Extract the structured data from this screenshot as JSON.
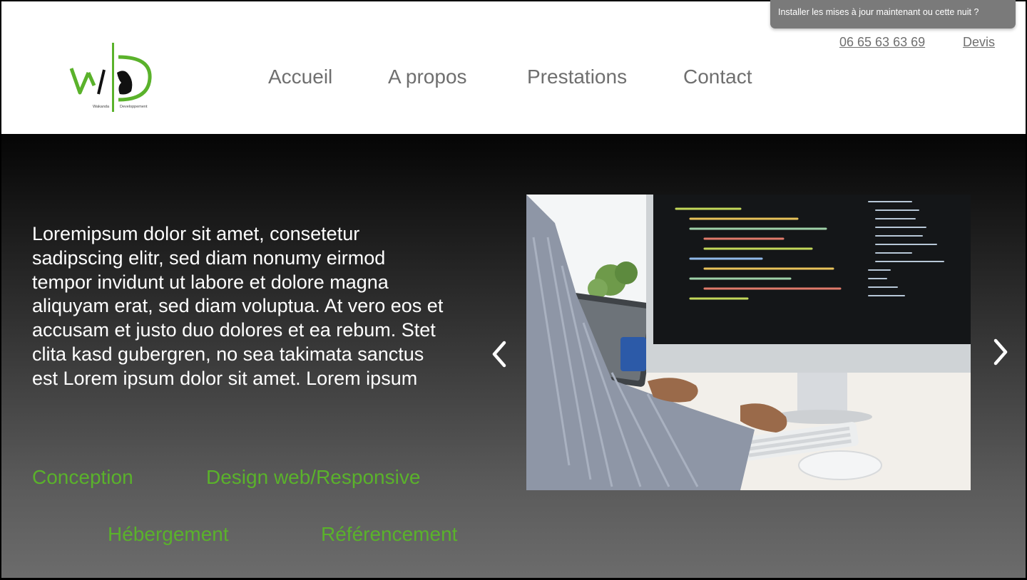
{
  "notification": {
    "text": "Installer les mises à jour maintenant ou cette nuit ?"
  },
  "header": {
    "logo": {
      "left_text": "Wakanda",
      "right_text": "Developpement",
      "icon": "wd-logo-icon"
    },
    "nav": [
      {
        "label": "Accueil"
      },
      {
        "label": "A propos"
      },
      {
        "label": "Prestations"
      },
      {
        "label": "Contact"
      }
    ],
    "phone": "06 65 63 63 69",
    "quote_link": "Devis"
  },
  "hero": {
    "text": "Loremipsum dolor sit amet, consetetur sadipscing elitr, sed diam nonumy eirmod tempor invidunt ut labore et dolore magna aliquyam erat, sed diam voluptua. At vero eos et accusam et justo duo dolores et ea rebum. Stet clita kasd gubergren, no sea takimata sanctus est Lorem ipsum dolor sit amet. Lorem ipsum",
    "services": [
      {
        "label": "Conception"
      },
      {
        "label": "Design web/Responsive"
      },
      {
        "label": "Hébergement"
      },
      {
        "label": "Référencement"
      }
    ],
    "carousel": {
      "prev_icon": "chevron-left-icon",
      "next_icon": "chevron-right-icon",
      "image": "developer-typing-at-computer-photo"
    }
  },
  "colors": {
    "accent_green": "#5ab22b",
    "nav_text": "#6f6f6f",
    "notification_bg": "#7a7a7a"
  }
}
